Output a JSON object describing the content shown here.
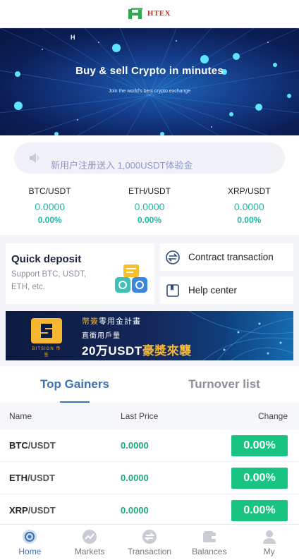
{
  "header": {
    "logo_text": "HTEX",
    "logo_sub": ""
  },
  "banner": {
    "title": "Buy & sell Crypto in minutes",
    "subtitle": "Join the world's best crypto exchange",
    "mark": "H"
  },
  "notice": {
    "text": "新用户注册送入 1,000USDT体验金"
  },
  "tickers": [
    {
      "pair": "BTC/USDT",
      "price": "0.0000",
      "change": "0.00%"
    },
    {
      "pair": "ETH/USDT",
      "price": "0.0000",
      "change": "0.00%"
    },
    {
      "pair": "XRP/USDT",
      "price": "0.0000",
      "change": "0.00%"
    }
  ],
  "quick_deposit": {
    "title": "Quick deposit",
    "description": "Support BTC, USDT, ETH, etc."
  },
  "side_links": [
    {
      "label": "Contract transaction",
      "icon": "exchange-arrows-icon"
    },
    {
      "label": "Help center",
      "icon": "book-icon"
    }
  ],
  "promo": {
    "brand": "BITSIGN 币签",
    "line1_gold": "幣簽",
    "line1_white": "零用金計畫",
    "line2": "直衝用戶量",
    "line3_white": "20万USDT",
    "line3_gold": "豪獎來襲"
  },
  "market": {
    "tabs": [
      "Top Gainers",
      "Turnover list"
    ],
    "active_tab": 0,
    "columns": [
      "Name",
      "Last Price",
      "Change"
    ],
    "rows": [
      {
        "base": "BTC",
        "quote": "/USDT",
        "price": "0.0000",
        "change": "0.00%"
      },
      {
        "base": "ETH",
        "quote": "/USDT",
        "price": "0.0000",
        "change": "0.00%"
      },
      {
        "base": "XRP",
        "quote": "/USDT",
        "price": "0.0000",
        "change": "0.00%"
      }
    ]
  },
  "nav": [
    {
      "label": "Home",
      "icon": "home-icon",
      "active": true
    },
    {
      "label": "Markets",
      "icon": "markets-icon",
      "active": false
    },
    {
      "label": "Transaction",
      "icon": "transaction-icon",
      "active": false
    },
    {
      "label": "Balances",
      "icon": "wallet-icon",
      "active": false
    },
    {
      "label": "My",
      "icon": "user-icon",
      "active": false
    }
  ],
  "colors": {
    "accent": "#3d72b5",
    "up_green": "#19c483",
    "price_teal": "#1eb8a0",
    "banner_dark": "#0b1f57",
    "promo_gold": "#f5b731"
  }
}
